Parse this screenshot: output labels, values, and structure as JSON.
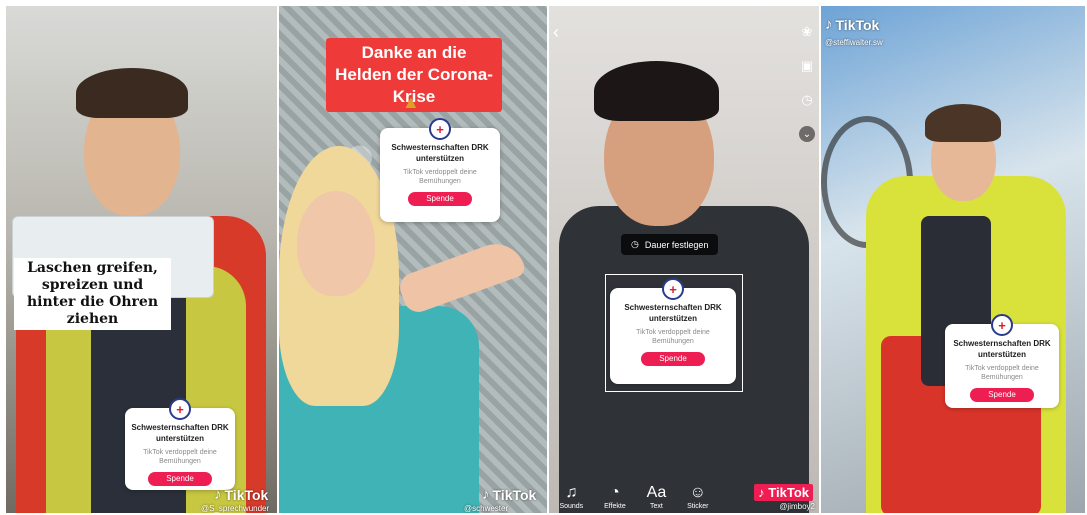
{
  "donation_card": {
    "title": "Schwesternschaften DRK unterstützen",
    "subtitle": "TikTok verdoppelt deine Bemühungen",
    "button": "Spende",
    "badge_symbol": "+"
  },
  "panels": [
    {
      "caption": "Laschen greifen, spreizen und hinter die Ohren ziehen",
      "watermark": "TikTok",
      "handle": "@S_sprechwunder"
    },
    {
      "headline": "Danke an die Helden der Corona-Krise",
      "emoji": "▲",
      "watermark": "TikTok",
      "handle": "@schwester"
    },
    {
      "duration_label": "Dauer festlegen",
      "tools": [
        {
          "icon": "♫",
          "label": "Sounds"
        },
        {
          "icon": "◔",
          "label": "Effekte"
        },
        {
          "icon": "Aa",
          "label": "Text"
        },
        {
          "icon": "☺",
          "label": "Sticker"
        }
      ],
      "side_tools": [
        "Filter",
        "",
        ""
      ],
      "watermark": "TikTok",
      "handle": "@jimboy2"
    },
    {
      "watermark": "TikTok",
      "handle": "@steffiwalter.sw"
    }
  ],
  "colors": {
    "tiktok_red": "#ee1d52",
    "drk_red": "#e0192b",
    "banner_red": "#ef3a3a"
  }
}
